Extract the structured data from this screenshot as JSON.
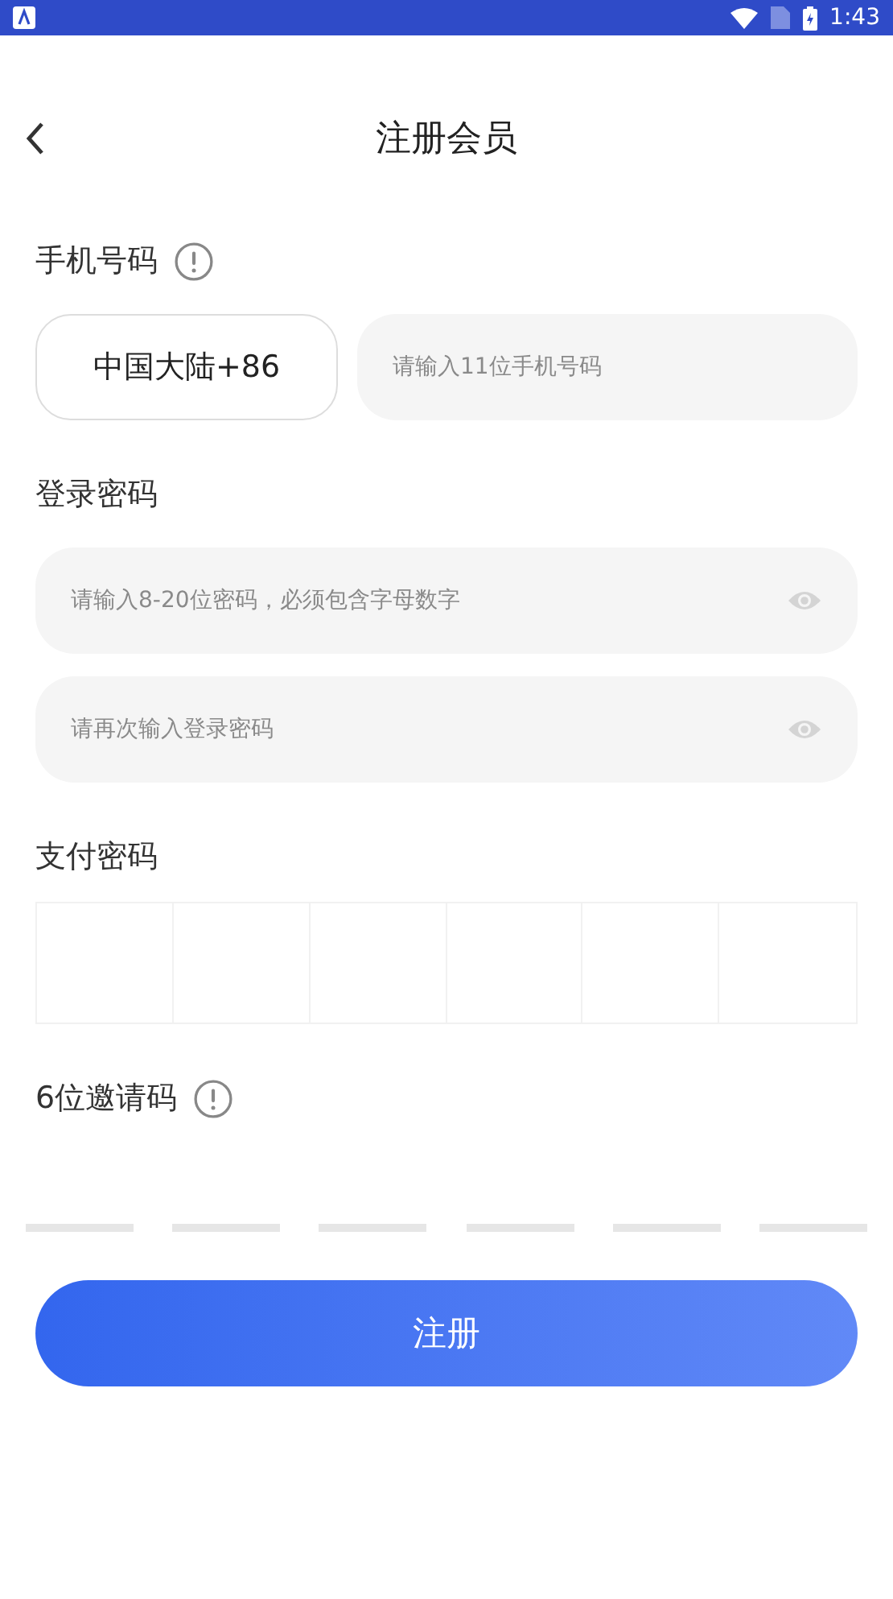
{
  "status_bar": {
    "time": "1:43"
  },
  "header": {
    "title": "注册会员"
  },
  "phone": {
    "label": "手机号码",
    "country_code": "中国大陆+86",
    "placeholder": "请输入11位手机号码"
  },
  "login_password": {
    "label": "登录密码",
    "fields": [
      {
        "placeholder": "请输入8-20位密码，必须包含字母数字"
      },
      {
        "placeholder": "请再次输入登录密码"
      }
    ]
  },
  "pay_password": {
    "label": "支付密码"
  },
  "invite_code": {
    "label": "6位邀请码"
  },
  "submit_button": "注册"
}
